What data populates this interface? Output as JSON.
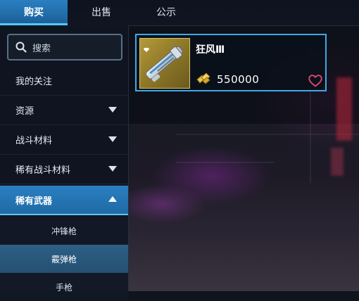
{
  "tabs": [
    {
      "label": "购买"
    },
    {
      "label": "出售"
    },
    {
      "label": "公示"
    }
  ],
  "sidebar": {
    "search_label": "搜索",
    "items": [
      {
        "label": "我的关注"
      },
      {
        "label": "资源"
      },
      {
        "label": "战斗材料"
      },
      {
        "label": "稀有战斗材料"
      },
      {
        "label": "稀有武器"
      }
    ],
    "subitems": [
      {
        "label": "冲锋枪"
      },
      {
        "label": "霰弹枪"
      },
      {
        "label": "手枪"
      }
    ]
  },
  "listing": {
    "name": "狂风Ⅲ",
    "price": "550000"
  },
  "colors": {
    "accent": "#2a7fc2",
    "card_border": "#3fa9e6",
    "heart": "#e0466e",
    "coin": "#e8c14a"
  }
}
